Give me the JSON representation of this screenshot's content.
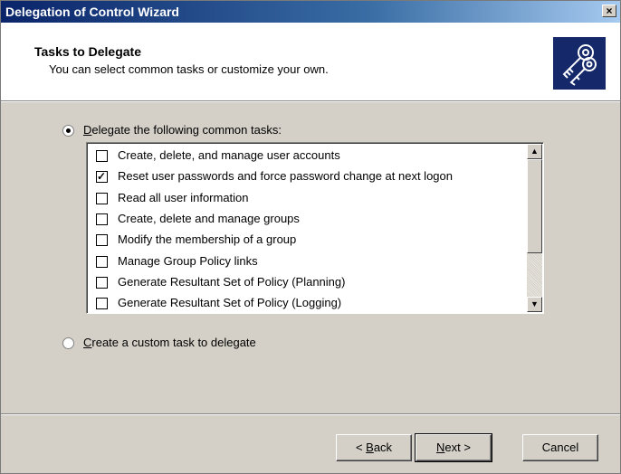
{
  "window": {
    "title": "Delegation of Control Wizard",
    "close_label": "×"
  },
  "header": {
    "title": "Tasks to Delegate",
    "subtitle": "You can select common tasks or customize your own.",
    "icon": "keys-icon"
  },
  "options": {
    "common": {
      "label_key": "D",
      "label_rest": "elegate the following common tasks:",
      "selected": true
    },
    "custom": {
      "label_key": "C",
      "label_rest": "reate a custom task to delegate",
      "selected": false
    }
  },
  "tasks": [
    {
      "label": "Create, delete, and manage user accounts",
      "checked": false
    },
    {
      "label": "Reset user passwords and force password change at next logon",
      "checked": true
    },
    {
      "label": "Read all user information",
      "checked": false
    },
    {
      "label": "Create, delete and manage groups",
      "checked": false
    },
    {
      "label": "Modify the membership of a group",
      "checked": false
    },
    {
      "label": "Manage Group Policy links",
      "checked": false
    },
    {
      "label": "Generate Resultant Set of Policy (Planning)",
      "checked": false
    },
    {
      "label": "Generate Resultant Set of Policy (Logging)",
      "checked": false
    }
  ],
  "buttons": {
    "back": {
      "pre": "< ",
      "key": "B",
      "rest": "ack"
    },
    "next": {
      "key": "N",
      "rest": "ext >"
    },
    "cancel": "Cancel"
  }
}
